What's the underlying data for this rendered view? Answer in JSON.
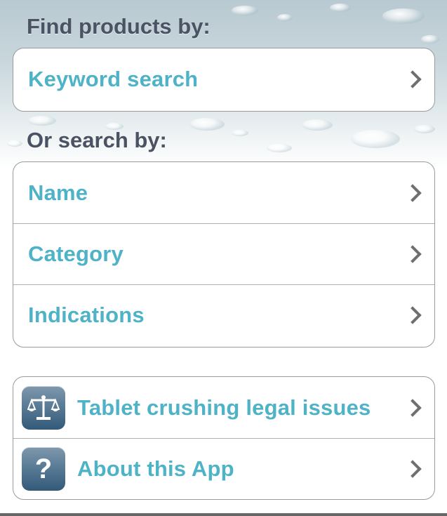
{
  "find_section": {
    "title": "Find products by:",
    "items": [
      {
        "label": "Keyword search"
      }
    ]
  },
  "search_section": {
    "title": "Or search by:",
    "items": [
      {
        "label": "Name"
      },
      {
        "label": "Category"
      },
      {
        "label": "Indications"
      }
    ]
  },
  "info_section": {
    "items": [
      {
        "label": "Tablet crushing legal issues",
        "icon": "scales-icon"
      },
      {
        "label": "About this App",
        "icon": "question-mark-icon"
      }
    ]
  },
  "colors": {
    "accent": "#4fb3c8",
    "heading": "#4a5363",
    "chevron": "#6f6f6f"
  }
}
